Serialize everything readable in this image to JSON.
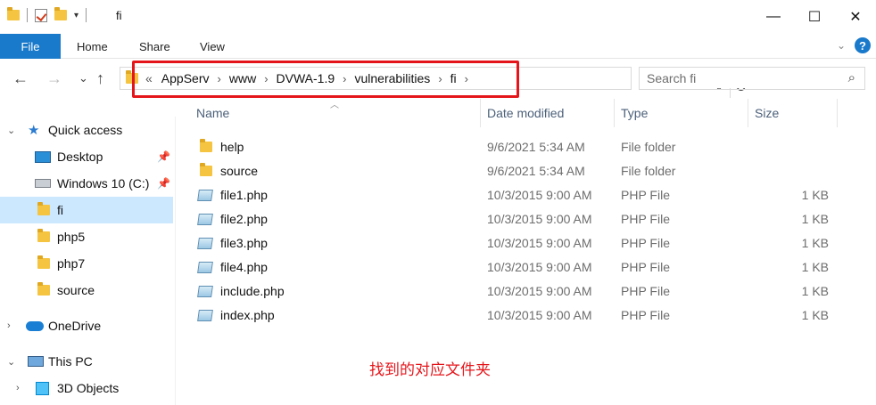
{
  "window": {
    "title": "fi",
    "controls": {
      "minimize": "—",
      "maximize": "☐",
      "close": "✕"
    }
  },
  "ribbon": {
    "tabs": [
      "File",
      "Home",
      "Share",
      "View"
    ],
    "help": "?"
  },
  "address": {
    "back": "←",
    "forward": "→",
    "recent": "⌄",
    "up": "↑",
    "overflow": "«",
    "crumbs": [
      "AppServ",
      "www",
      "DVWA-1.9",
      "vulnerabilities",
      "fi"
    ],
    "separator": "›",
    "refresh": "↻",
    "search_placeholder": "Search fi",
    "highlight_color": "#e5161b"
  },
  "sidebar": {
    "items": [
      {
        "label": "Quick access",
        "icon": "star-icon"
      },
      {
        "label": "Desktop",
        "icon": "desktop-icon",
        "pinned": true
      },
      {
        "label": "Windows 10 (C:)",
        "icon": "drive-icon",
        "pinned": true
      },
      {
        "label": "fi",
        "icon": "folder-icon",
        "selected": true
      },
      {
        "label": "php5",
        "icon": "folder-icon"
      },
      {
        "label": "php7",
        "icon": "folder-icon"
      },
      {
        "label": "source",
        "icon": "folder-icon"
      },
      {
        "label": "OneDrive",
        "icon": "cloud-icon"
      },
      {
        "label": "This PC",
        "icon": "computer-icon"
      },
      {
        "label": "3D Objects",
        "icon": "cube-icon"
      }
    ]
  },
  "files": {
    "columns": [
      "Name",
      "Date modified",
      "Type",
      "Size"
    ],
    "rows": [
      {
        "name": "help",
        "date": "9/6/2021 5:34 AM",
        "type": "File folder",
        "size": "",
        "icon": "folder-icon"
      },
      {
        "name": "source",
        "date": "9/6/2021 5:34 AM",
        "type": "File folder",
        "size": "",
        "icon": "folder-icon"
      },
      {
        "name": "file1.php",
        "date": "10/3/2015 9:00 AM",
        "type": "PHP File",
        "size": "1 KB",
        "icon": "php-file-icon"
      },
      {
        "name": "file2.php",
        "date": "10/3/2015 9:00 AM",
        "type": "PHP File",
        "size": "1 KB",
        "icon": "php-file-icon"
      },
      {
        "name": "file3.php",
        "date": "10/3/2015 9:00 AM",
        "type": "PHP File",
        "size": "1 KB",
        "icon": "php-file-icon"
      },
      {
        "name": "file4.php",
        "date": "10/3/2015 9:00 AM",
        "type": "PHP File",
        "size": "1 KB",
        "icon": "php-file-icon"
      },
      {
        "name": "include.php",
        "date": "10/3/2015 9:00 AM",
        "type": "PHP File",
        "size": "1 KB",
        "icon": "php-file-icon"
      },
      {
        "name": "index.php",
        "date": "10/3/2015 9:00 AM",
        "type": "PHP File",
        "size": "1 KB",
        "icon": "php-file-icon"
      }
    ]
  },
  "annotation": "找到的对应文件夹"
}
